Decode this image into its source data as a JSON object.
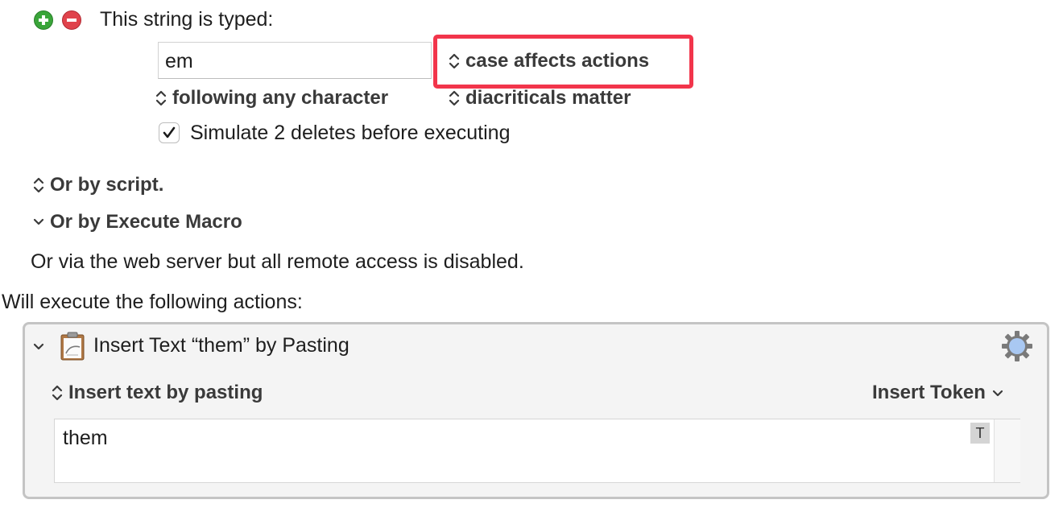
{
  "trigger": {
    "header_label": "This string is typed:",
    "typed_string_value": "em",
    "case_popup_label": "case affects actions",
    "following_popup_label": "following any character",
    "diacriticals_popup_label": "diacriticals matter",
    "simulate_deletes_label": "Simulate 2 deletes before executing",
    "simulate_deletes_checked": true
  },
  "sections": {
    "script_label": "Or by script.",
    "execute_macro_label": "Or by Execute Macro",
    "web_server_text": "Or via the web server but all remote access is disabled."
  },
  "actions": {
    "header": "Will execute the following actions:",
    "items": [
      {
        "title": "Insert Text “them” by Pasting",
        "mode_label": "Insert text by pasting",
        "insert_token_label": "Insert Token",
        "text_value": "them",
        "token_badge": "T"
      }
    ]
  },
  "colors": {
    "highlight": "#f2354b",
    "add_button": "#3aa53a",
    "remove_button": "#e0434c",
    "gear_accent": "#a9c8f2"
  },
  "icons": [
    "add-icon",
    "remove-icon",
    "updown-chevron-icon",
    "chevron-down-icon",
    "checkmark-icon",
    "clipboard-icon",
    "gear-icon"
  ]
}
